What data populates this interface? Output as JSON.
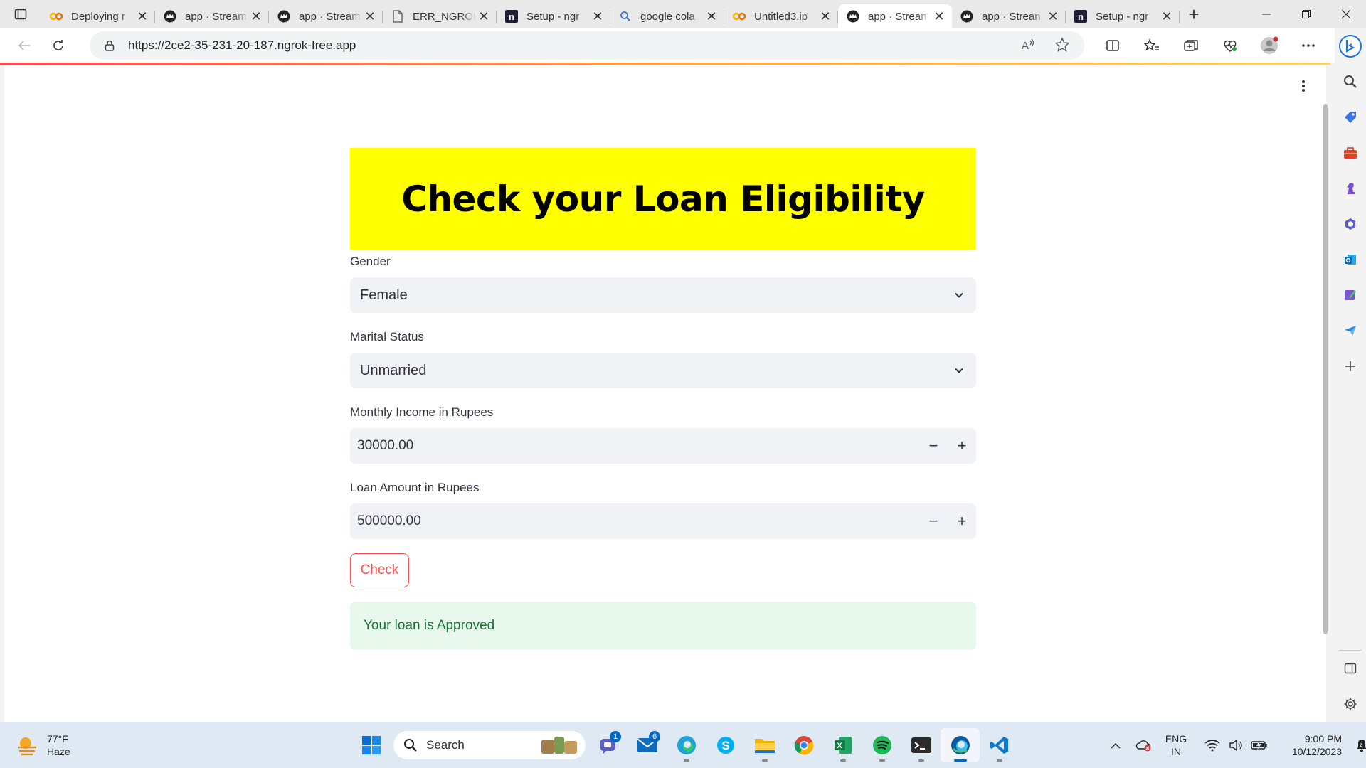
{
  "browser": {
    "tabs": [
      {
        "title": "Deploying r",
        "icon": "colab-icon",
        "active": false
      },
      {
        "title": "app · Stream",
        "icon": "streamlit-crown-icon",
        "active": false
      },
      {
        "title": "app · Stream",
        "icon": "streamlit-crown-icon",
        "active": false
      },
      {
        "title": "ERR_NGROK",
        "icon": "page-icon",
        "active": false
      },
      {
        "title": "Setup - ngr",
        "icon": "ngrok-icon",
        "active": false
      },
      {
        "title": "google cola",
        "icon": "search-icon",
        "active": false
      },
      {
        "title": "Untitled3.ip",
        "icon": "colab-icon",
        "active": false
      },
      {
        "title": "app · Strean",
        "icon": "streamlit-crown-icon",
        "active": true
      },
      {
        "title": "app · Strean",
        "icon": "streamlit-crown-icon",
        "active": false
      },
      {
        "title": "Setup - ngr",
        "icon": "ngrok-icon",
        "active": false
      }
    ],
    "tab_close_glyph": "✕",
    "new_tab_glyph": "+",
    "address": {
      "url": "https://2ce2-35-231-20-187.ngrok-free.app"
    },
    "accent": "#0078d4"
  },
  "app": {
    "title": "Check your Loan Eligibility",
    "banner_color": "#ffff00",
    "gender": {
      "label": "Gender",
      "value": "Female"
    },
    "marital": {
      "label": "Marital Status",
      "value": "Unmarried"
    },
    "income": {
      "label": "Monthly Income in Rupees",
      "value": "30000.00",
      "minus": "−",
      "plus": "+"
    },
    "loan": {
      "label": "Loan Amount in Rupees",
      "value": "500000.00",
      "minus": "−",
      "plus": "+"
    },
    "check_button": "Check",
    "result": "Your loan is Approved",
    "primary_color": "#ff4b4b",
    "success_color": "#177233"
  },
  "taskbar": {
    "weather": {
      "temp": "77°F",
      "condition": "Haze"
    },
    "search_placeholder": "Search",
    "badges": {
      "teams": "1",
      "mail": "6"
    },
    "lang": {
      "line1": "ENG",
      "line2": "IN"
    },
    "clock": {
      "time": "9:00 PM",
      "date": "10/12/2023"
    }
  }
}
